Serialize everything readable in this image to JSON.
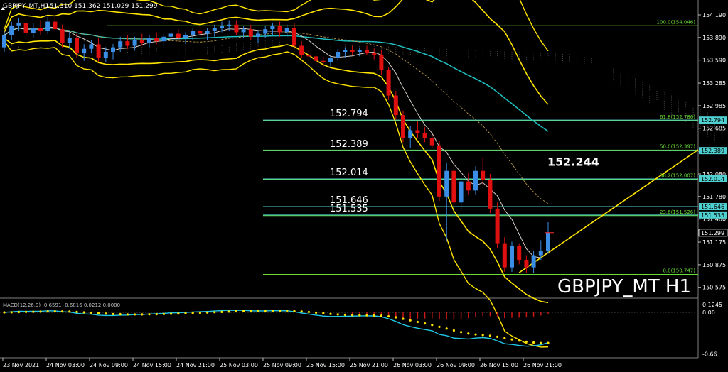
{
  "window": {
    "title": "GBPJPY_MT,H1",
    "ohlc": "151.310 151.362 151.029 151.299",
    "watermark": "GBPJPY_MT H1",
    "macd_label": "MACD(12,26,9) -0.6591 -0.6816 0.0212 0.0000"
  },
  "colors": {
    "bg": "#000000",
    "bull": "#3a8ee6",
    "bear": "#e01010",
    "envelope": "#ffe400",
    "fib": "#66dd33",
    "hline": "#4fd0d0",
    "ma_cyan": "#20c0c0",
    "ma_white": "#d8d0c8",
    "macd_signal": "#ffe400",
    "macd_main": "#20c8e8",
    "hist": "#c81818",
    "axis_text": "#ffffff",
    "grid_text": "#c0c0c0"
  },
  "chart_data": {
    "type": "candlestick",
    "symbol": "GBPJPY_MT",
    "timeframe": "H1",
    "ylim": [
      150.45,
      154.35
    ],
    "y_ticks": [
      "154.190",
      "153.890",
      "153.590",
      "153.285",
      "152.985",
      "152.685",
      "152.380",
      "152.080",
      "151.780",
      "151.480",
      "151.175",
      "150.875",
      "150.575"
    ],
    "x_ticks": [
      "23 Nov 2021",
      "24 Nov 03:00",
      "24 Nov 09:00",
      "24 Nov 15:00",
      "24 Nov 21:00",
      "25 Nov 03:00",
      "25 Nov 09:00",
      "25 Nov 15:00",
      "25 Nov 21:00",
      "26 Nov 03:00",
      "26 Nov 09:00",
      "26 Nov 15:00",
      "26 Nov 21:00"
    ],
    "candles": [
      [
        153.76,
        153.98,
        153.7,
        153.92
      ],
      [
        153.92,
        154.1,
        153.86,
        154.05
      ],
      [
        154.05,
        154.15,
        153.98,
        154.08
      ],
      [
        154.08,
        154.14,
        153.9,
        153.95
      ],
      [
        153.95,
        154.08,
        153.88,
        154.02
      ],
      [
        154.02,
        154.12,
        153.92,
        153.98
      ],
      [
        153.98,
        154.16,
        153.94,
        154.1
      ],
      [
        154.1,
        154.2,
        153.96,
        154.0
      ],
      [
        154.0,
        154.06,
        153.76,
        153.82
      ],
      [
        153.82,
        153.96,
        153.74,
        153.88
      ],
      [
        153.88,
        153.94,
        153.62,
        153.68
      ],
      [
        153.68,
        153.8,
        153.58,
        153.74
      ],
      [
        153.74,
        153.86,
        153.68,
        153.8
      ],
      [
        153.8,
        153.88,
        153.56,
        153.62
      ],
      [
        153.62,
        153.76,
        153.56,
        153.7
      ],
      [
        153.7,
        153.8,
        153.6,
        153.76
      ],
      [
        153.76,
        153.9,
        153.7,
        153.84
      ],
      [
        153.84,
        153.92,
        153.74,
        153.78
      ],
      [
        153.78,
        153.9,
        153.72,
        153.86
      ],
      [
        153.86,
        153.94,
        153.78,
        153.82
      ],
      [
        153.82,
        153.92,
        153.76,
        153.88
      ],
      [
        153.88,
        153.96,
        153.8,
        153.84
      ],
      [
        153.84,
        153.94,
        153.76,
        153.9
      ],
      [
        153.9,
        153.98,
        153.84,
        153.94
      ],
      [
        153.94,
        154.0,
        153.84,
        153.88
      ],
      [
        153.88,
        153.96,
        153.8,
        153.92
      ],
      [
        153.92,
        154.02,
        153.86,
        153.98
      ],
      [
        153.98,
        154.04,
        153.9,
        153.94
      ],
      [
        153.94,
        154.02,
        153.86,
        153.98
      ],
      [
        153.98,
        154.06,
        153.9,
        154.02
      ],
      [
        154.02,
        154.1,
        153.96,
        154.04
      ],
      [
        154.04,
        154.12,
        153.98,
        154.06
      ],
      [
        154.06,
        154.12,
        153.92,
        153.96
      ],
      [
        153.96,
        154.04,
        153.88,
        154.0
      ],
      [
        154.0,
        154.06,
        153.86,
        153.9
      ],
      [
        153.9,
        153.98,
        153.82,
        153.94
      ],
      [
        153.94,
        154.04,
        153.88,
        154.0
      ],
      [
        154.0,
        154.08,
        153.92,
        154.04
      ],
      [
        154.04,
        154.1,
        153.9,
        153.96
      ],
      [
        153.96,
        154.06,
        153.9,
        154.02
      ],
      [
        154.02,
        154.08,
        153.74,
        153.78
      ],
      [
        153.78,
        153.84,
        153.62,
        153.66
      ],
      [
        153.66,
        153.74,
        153.56,
        153.64
      ],
      [
        153.64,
        153.68,
        153.52,
        153.58
      ],
      [
        153.58,
        153.64,
        153.5,
        153.56
      ],
      [
        153.56,
        153.66,
        153.5,
        153.62
      ],
      [
        153.62,
        153.74,
        153.58,
        153.7
      ],
      [
        153.7,
        153.76,
        153.62,
        153.72
      ],
      [
        153.72,
        153.78,
        153.66,
        153.7
      ],
      [
        153.7,
        153.76,
        153.64,
        153.72
      ],
      [
        153.72,
        153.78,
        153.66,
        153.68
      ],
      [
        153.68,
        153.74,
        153.6,
        153.66
      ],
      [
        153.66,
        153.72,
        153.4,
        153.46
      ],
      [
        153.46,
        153.5,
        153.06,
        153.12
      ],
      [
        153.12,
        153.18,
        152.8,
        152.86
      ],
      [
        152.86,
        152.92,
        152.5,
        152.56
      ],
      [
        152.56,
        152.72,
        152.42,
        152.66
      ],
      [
        152.66,
        152.78,
        152.56,
        152.62
      ],
      [
        152.62,
        152.7,
        152.5,
        152.56
      ],
      [
        152.56,
        152.6,
        152.42,
        152.46
      ],
      [
        152.46,
        152.52,
        151.72,
        151.78
      ],
      [
        151.78,
        152.22,
        151.18,
        152.12
      ],
      [
        152.12,
        152.18,
        151.64,
        151.7
      ],
      [
        151.7,
        152.06,
        151.6,
        151.98
      ],
      [
        151.98,
        152.1,
        151.8,
        151.86
      ],
      [
        151.86,
        152.18,
        151.8,
        152.12
      ],
      [
        152.12,
        152.3,
        151.94,
        152.0
      ],
      [
        152.0,
        152.08,
        151.56,
        151.62
      ],
      [
        151.62,
        151.7,
        151.1,
        151.16
      ],
      [
        151.16,
        151.24,
        150.78,
        150.84
      ],
      [
        150.84,
        151.18,
        150.78,
        151.12
      ],
      [
        151.12,
        151.16,
        150.88,
        150.94
      ],
      [
        150.94,
        151.0,
        150.76,
        150.84
      ],
      [
        150.84,
        151.06,
        150.76,
        151.0
      ],
      [
        151.0,
        151.2,
        150.94,
        151.06
      ],
      [
        151.06,
        151.44,
        151.02,
        151.3
      ]
    ],
    "horizontal_levels": [
      {
        "label": "152.794",
        "value": 152.794
      },
      {
        "label": "152.389",
        "value": 152.389
      },
      {
        "label": "152.014",
        "value": 152.014
      },
      {
        "label": "151.646",
        "value": 151.646
      },
      {
        "label": "151.535",
        "value": 151.535
      }
    ],
    "fibonacci": [
      {
        "label": "100.0(154.046)",
        "value": 154.046
      },
      {
        "label": "61.8(152.786)",
        "value": 152.786
      },
      {
        "label": "50.0(152.397)",
        "value": 152.397
      },
      {
        "label": "38.2(152.007)",
        "value": 152.007
      },
      {
        "label": "23.6(151.526)",
        "value": 151.526
      },
      {
        "label": "0.0(150.747)",
        "value": 150.747
      }
    ],
    "price_tags": [
      {
        "label": "152.794",
        "value": 152.794
      },
      {
        "label": "152.389",
        "value": 152.389
      },
      {
        "label": "152.014",
        "value": 152.014
      },
      {
        "label": "151.646",
        "value": 151.646
      },
      {
        "label": "151.535",
        "value": 151.535
      },
      {
        "label": "151.299",
        "value": 151.299
      }
    ],
    "annotation": {
      "label": "152.244",
      "value": 152.244
    },
    "macd": {
      "y_ticks": [
        "0.1245",
        "0.00",
        "-0.66"
      ],
      "ylim": [
        -0.72,
        0.18
      ]
    }
  }
}
